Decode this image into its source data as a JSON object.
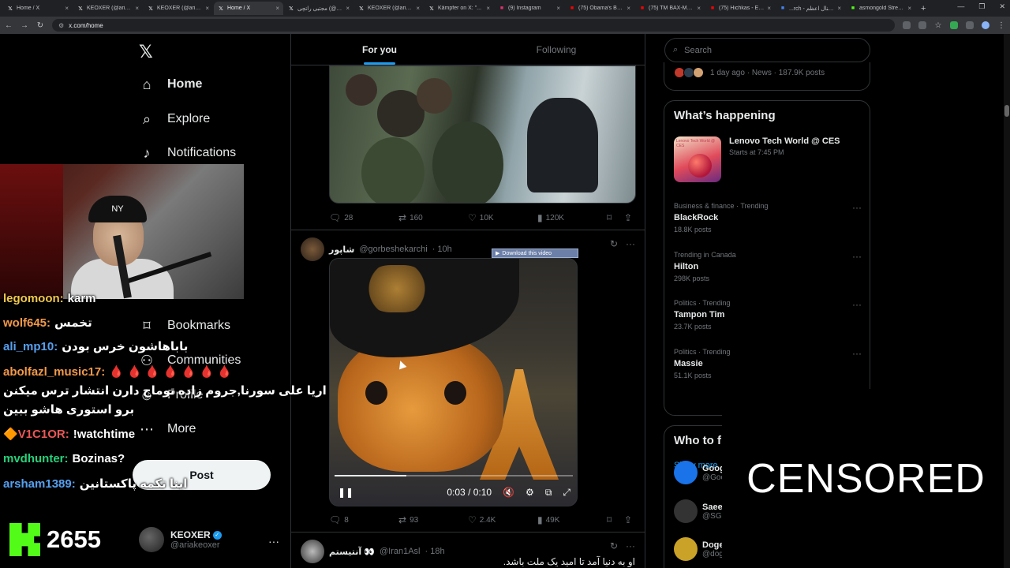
{
  "browser": {
    "tabs": [
      {
        "title": "Home / X",
        "icon": "x-icon",
        "color": "#e7e9ea"
      },
      {
        "title": "KEOXER (@ariakeoxer)",
        "icon": "x-icon",
        "color": "#e7e9ea"
      },
      {
        "title": "KEOXER (@ariakeoxer)",
        "icon": "x-icon",
        "color": "#e7e9ea"
      },
      {
        "title": "Home / X",
        "icon": "x-icon",
        "color": "#e7e9ea",
        "active": true
      },
      {
        "title": "مجتبی راتچی (@...)",
        "icon": "x-icon",
        "color": "#e7e9ea"
      },
      {
        "title": "KEOXER (@ariakeoxer)",
        "icon": "x-icon",
        "color": "#e7e9ea"
      },
      {
        "title": "Kämpfer on X: \"...",
        "icon": "x-icon",
        "color": "#e7e9ea"
      },
      {
        "title": "(9) Instagram",
        "icon": "instagram-icon",
        "color": "#e1306c"
      },
      {
        "title": "(75) Obama's Bin L...",
        "icon": "youtube-icon",
        "color": "#ff0000"
      },
      {
        "title": "(75) TM BAX-MEYD...",
        "icon": "youtube-icon",
        "color": "#ff0000"
      },
      {
        "title": "(75) Hichkas - Ekhta...",
        "icon": "youtube-icon",
        "color": "#ff0000"
      },
      {
        "title": "...rch - کمکنال اعظم",
        "icon": "google-icon",
        "color": "#4285f4"
      },
      {
        "title": "asmongold Stream...",
        "icon": "kick-icon",
        "color": "#53fc18"
      }
    ],
    "url": "x.com/home"
  },
  "nav": {
    "home": "Home",
    "explore": "Explore",
    "notifications": "Notifications",
    "bookmarks": "Bookmarks",
    "communities": "Communities",
    "profile": "Profile",
    "more": "More",
    "post": "Post",
    "account_name": "KEOXER",
    "account_handle": "@ariakeoxer"
  },
  "timeline": {
    "tab_for_you": "For you",
    "tab_following": "Following",
    "tweet1": {
      "replies": "28",
      "reposts": "160",
      "likes": "10K",
      "views": "120K"
    },
    "tweet2": {
      "name": "شاپور",
      "handle": "@gorbeshekarchi",
      "time": "· 10h",
      "download_label": "Download this video",
      "video_time": "0:03 / 0:10",
      "video_progress": 0.3,
      "replies": "8",
      "reposts": "93",
      "likes": "2.4K",
      "views": "49K"
    },
    "tweet3": {
      "name": "آنتیستم 👀",
      "handle": "@Iran1Asl",
      "time": "· 18h",
      "text": "او به دنیا آمد تا امید یک ملت باشد."
    }
  },
  "sidebar": {
    "search_placeholder": "Search",
    "news_meta": "1 day ago · News · 187.9K posts",
    "whats_happening": "What’s happening",
    "event": {
      "title": "Lenovo Tech World @ CES",
      "sub": "Starts at 7:45 PM",
      "img_label": "Lenovo Tech World @ CES"
    },
    "trends": [
      {
        "context": "Business & finance · Trending",
        "name": "BlackRock",
        "count": "18.8K posts"
      },
      {
        "context": "Trending in Canada",
        "name": "Hilton",
        "count": "298K posts"
      },
      {
        "context": "Politics · Trending",
        "name": "Tampon Tim",
        "count": "23.7K posts"
      },
      {
        "context": "Politics · Trending",
        "name": "Massie",
        "count": "51.1K posts"
      }
    ],
    "show_more": "Show more",
    "who_to_follow": "Who to f",
    "follow": [
      {
        "name": "Goog",
        "handle": "@Goo",
        "color": "#1a73e8"
      },
      {
        "name": "Saee",
        "handle": "@SG",
        "color": "#333333"
      },
      {
        "name": "Doge",
        "handle": "@dog",
        "color": "#c9a227"
      }
    ],
    "censored": "CENSORED"
  },
  "stream": {
    "webcam_hat": "NY",
    "chat": [
      {
        "user": "legomoon:",
        "msg": "karm",
        "color": "#f2c94c"
      },
      {
        "user": "wolf645:",
        "msg": "تخمس",
        "color": "#f2994a"
      },
      {
        "user": "ali_mp10:",
        "msg": "باباهاشون خرس بودن",
        "color": "#56a0f0"
      },
      {
        "user": "abolfazl_music17:",
        "msg": "🩸 🩸 🩸 🩸 🩸 🩸 🩸",
        "color": "#f2994a"
      },
      {
        "user": "",
        "msg": "اریا علی سورنا,جروم زاده توماج دارن انتشار ترس میکنن",
        "color": "#ffffff"
      },
      {
        "user": "",
        "msg": "برو استوری هاشو ببین",
        "color": "#ffffff"
      },
      {
        "user": "🔶V1C1OR:",
        "msg": "!watchtime",
        "color": "#eb5757"
      },
      {
        "user": "mvdhunter:",
        "msg": "Bozinas?",
        "color": "#27d07a"
      },
      {
        "user": "arsham1389:",
        "msg": "اینا تکمه پاکستانین",
        "color": "#56a0f0"
      }
    ],
    "viewers": "2655"
  }
}
